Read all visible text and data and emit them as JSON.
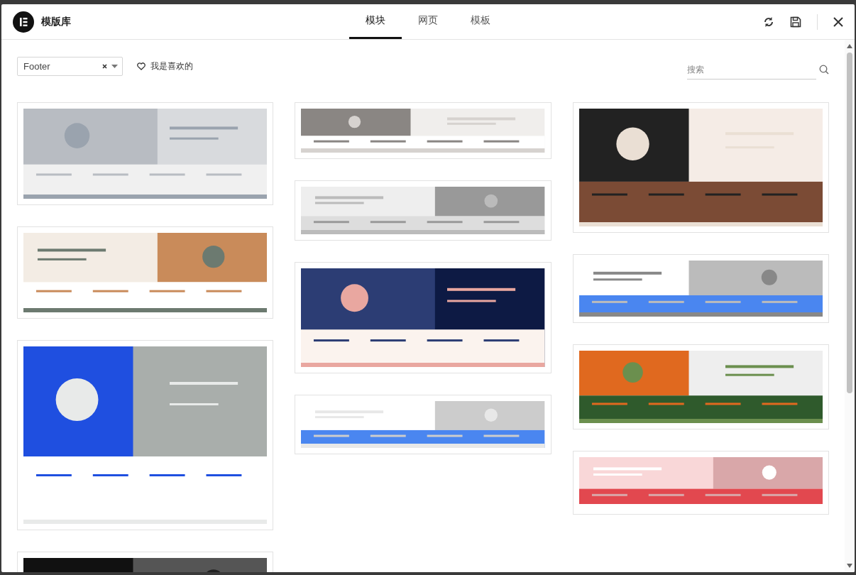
{
  "header": {
    "title": "模版库",
    "tabs": [
      {
        "label": "模块",
        "selected": true
      },
      {
        "label": "网页",
        "selected": false
      },
      {
        "label": "模板",
        "selected": false
      }
    ]
  },
  "filters": {
    "category": {
      "value": "Footer"
    },
    "favorites": {
      "label": "我是喜欢的"
    },
    "search": {
      "placeholder": "搜索"
    }
  }
}
